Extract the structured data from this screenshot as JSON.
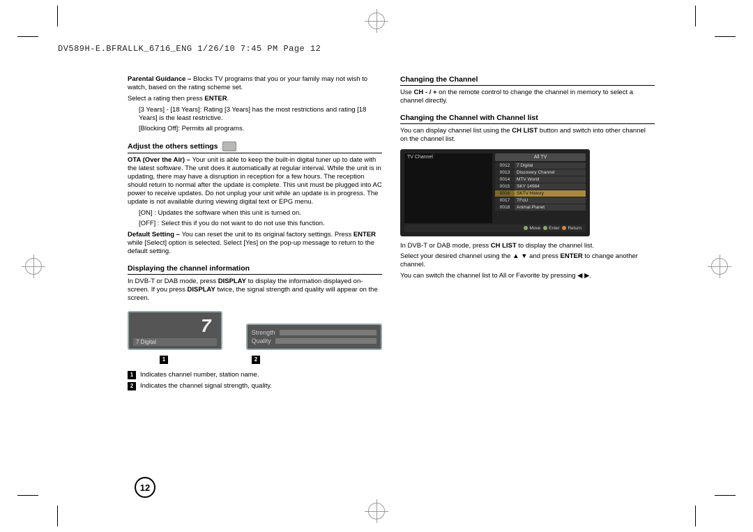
{
  "header_line": "DV589H-E.BFRALLK_6716_ENG  1/26/10  7:45 PM  Page 12",
  "left": {
    "pg_lead": "Parental Guidance – ",
    "pg_body": "Blocks TV programs that you or your family may not wish to watch, based on the rating scheme set.",
    "pg_select": "Select a rating then press ",
    "enter1": "ENTER",
    "pg_select2": ".",
    "pg_note": "[3 Years] - [18 Years]: Rating [3 Years] has the most restrictions and rating [18 Years] is the least restrictive.",
    "pg_off": "[Blocking Off]: Permits all programs.",
    "adjust_head": "Adjust the others settings",
    "ota_lead": "OTA (Over the Air) – ",
    "ota_body": "Your unit is able to keep the built-in digital tuner up to date with the latest software. The unit does it automatically at regular interval. While the unit is in updating, there may have a disruption in reception for a few hours. The reception should return to normal after the update is complete. This unit must be plugged into AC power to receive updates. Do not unplug your unit while an update is in progress. The update is not available during viewing digital text or EPG menu.",
    "ota_on": "[ON] : Updates the software when this unit is turned on.",
    "ota_off": "[OFF] : Select this if you do not want to do not use this function.",
    "def_lead": "Default Setting – ",
    "def_body_a": "You can reset the unit to its original factory settings. Press ",
    "enter2": "ENTER",
    "def_body_b": " while [Select] option is selected. Select [Yes] on the pop-up message to return to the default setting.",
    "disp_head": "Displaying the channel information",
    "disp_a": "In DVB-T or DAB mode, press ",
    "display1": "DISPLAY",
    "disp_b": " to display the information displayed on-screen. If you press ",
    "display2": "DISPLAY",
    "disp_c": " twice, the signal strength and quality will appear on the screen.",
    "fig1_num": "7",
    "fig1_name": "7 Digital",
    "fig2_strength": "Strength",
    "fig2_quality": "Quality",
    "badge1": "1",
    "badge2": "2",
    "legend1": "Indicates channel number, station name.",
    "legend2": "Indicates the channel signal strength, quality."
  },
  "right": {
    "chg_head": "Changing the Channel",
    "chg_a": "Use ",
    "chg_b": "CH - / +",
    "chg_c": " on the remote control to change the channel in memory to select a channel directly.",
    "chlist_head": "Changing the Channel with Channel list",
    "chlist_a": "You can display channel list using the ",
    "chlist_b": "CH LIST",
    "chlist_c": " button and switch into other channel on the channel list.",
    "img_title": "TV Channel",
    "img_tab": "All TV",
    "ch_rows": [
      {
        "num": "0012",
        "name": "7 Digital"
      },
      {
        "num": "0013",
        "name": "Discovery Channel"
      },
      {
        "num": "0014",
        "name": "MTV World"
      },
      {
        "num": "0015",
        "name": "SKY 14984"
      },
      {
        "num": "0016",
        "name": "SKTV History"
      },
      {
        "num": "0017",
        "name": "TFoU"
      },
      {
        "num": "0018",
        "name": "Animal Planet"
      }
    ],
    "ch_sel_index": 4,
    "footer_move": "Move",
    "footer_enter": "Enter",
    "footer_return": "Return",
    "p1a": "In DVB-T or DAB mode, press ",
    "p1b": "CH LIST",
    "p1c": " to display the channel list.",
    "p2a": "Select your desired channel using the ▲ ▼ and press ",
    "p2b": "ENTER",
    "p2c": " to change another channel.",
    "p3": "You can switch the channel list to All or Favorite by pressing ◀ ▶."
  },
  "page_number": "12"
}
